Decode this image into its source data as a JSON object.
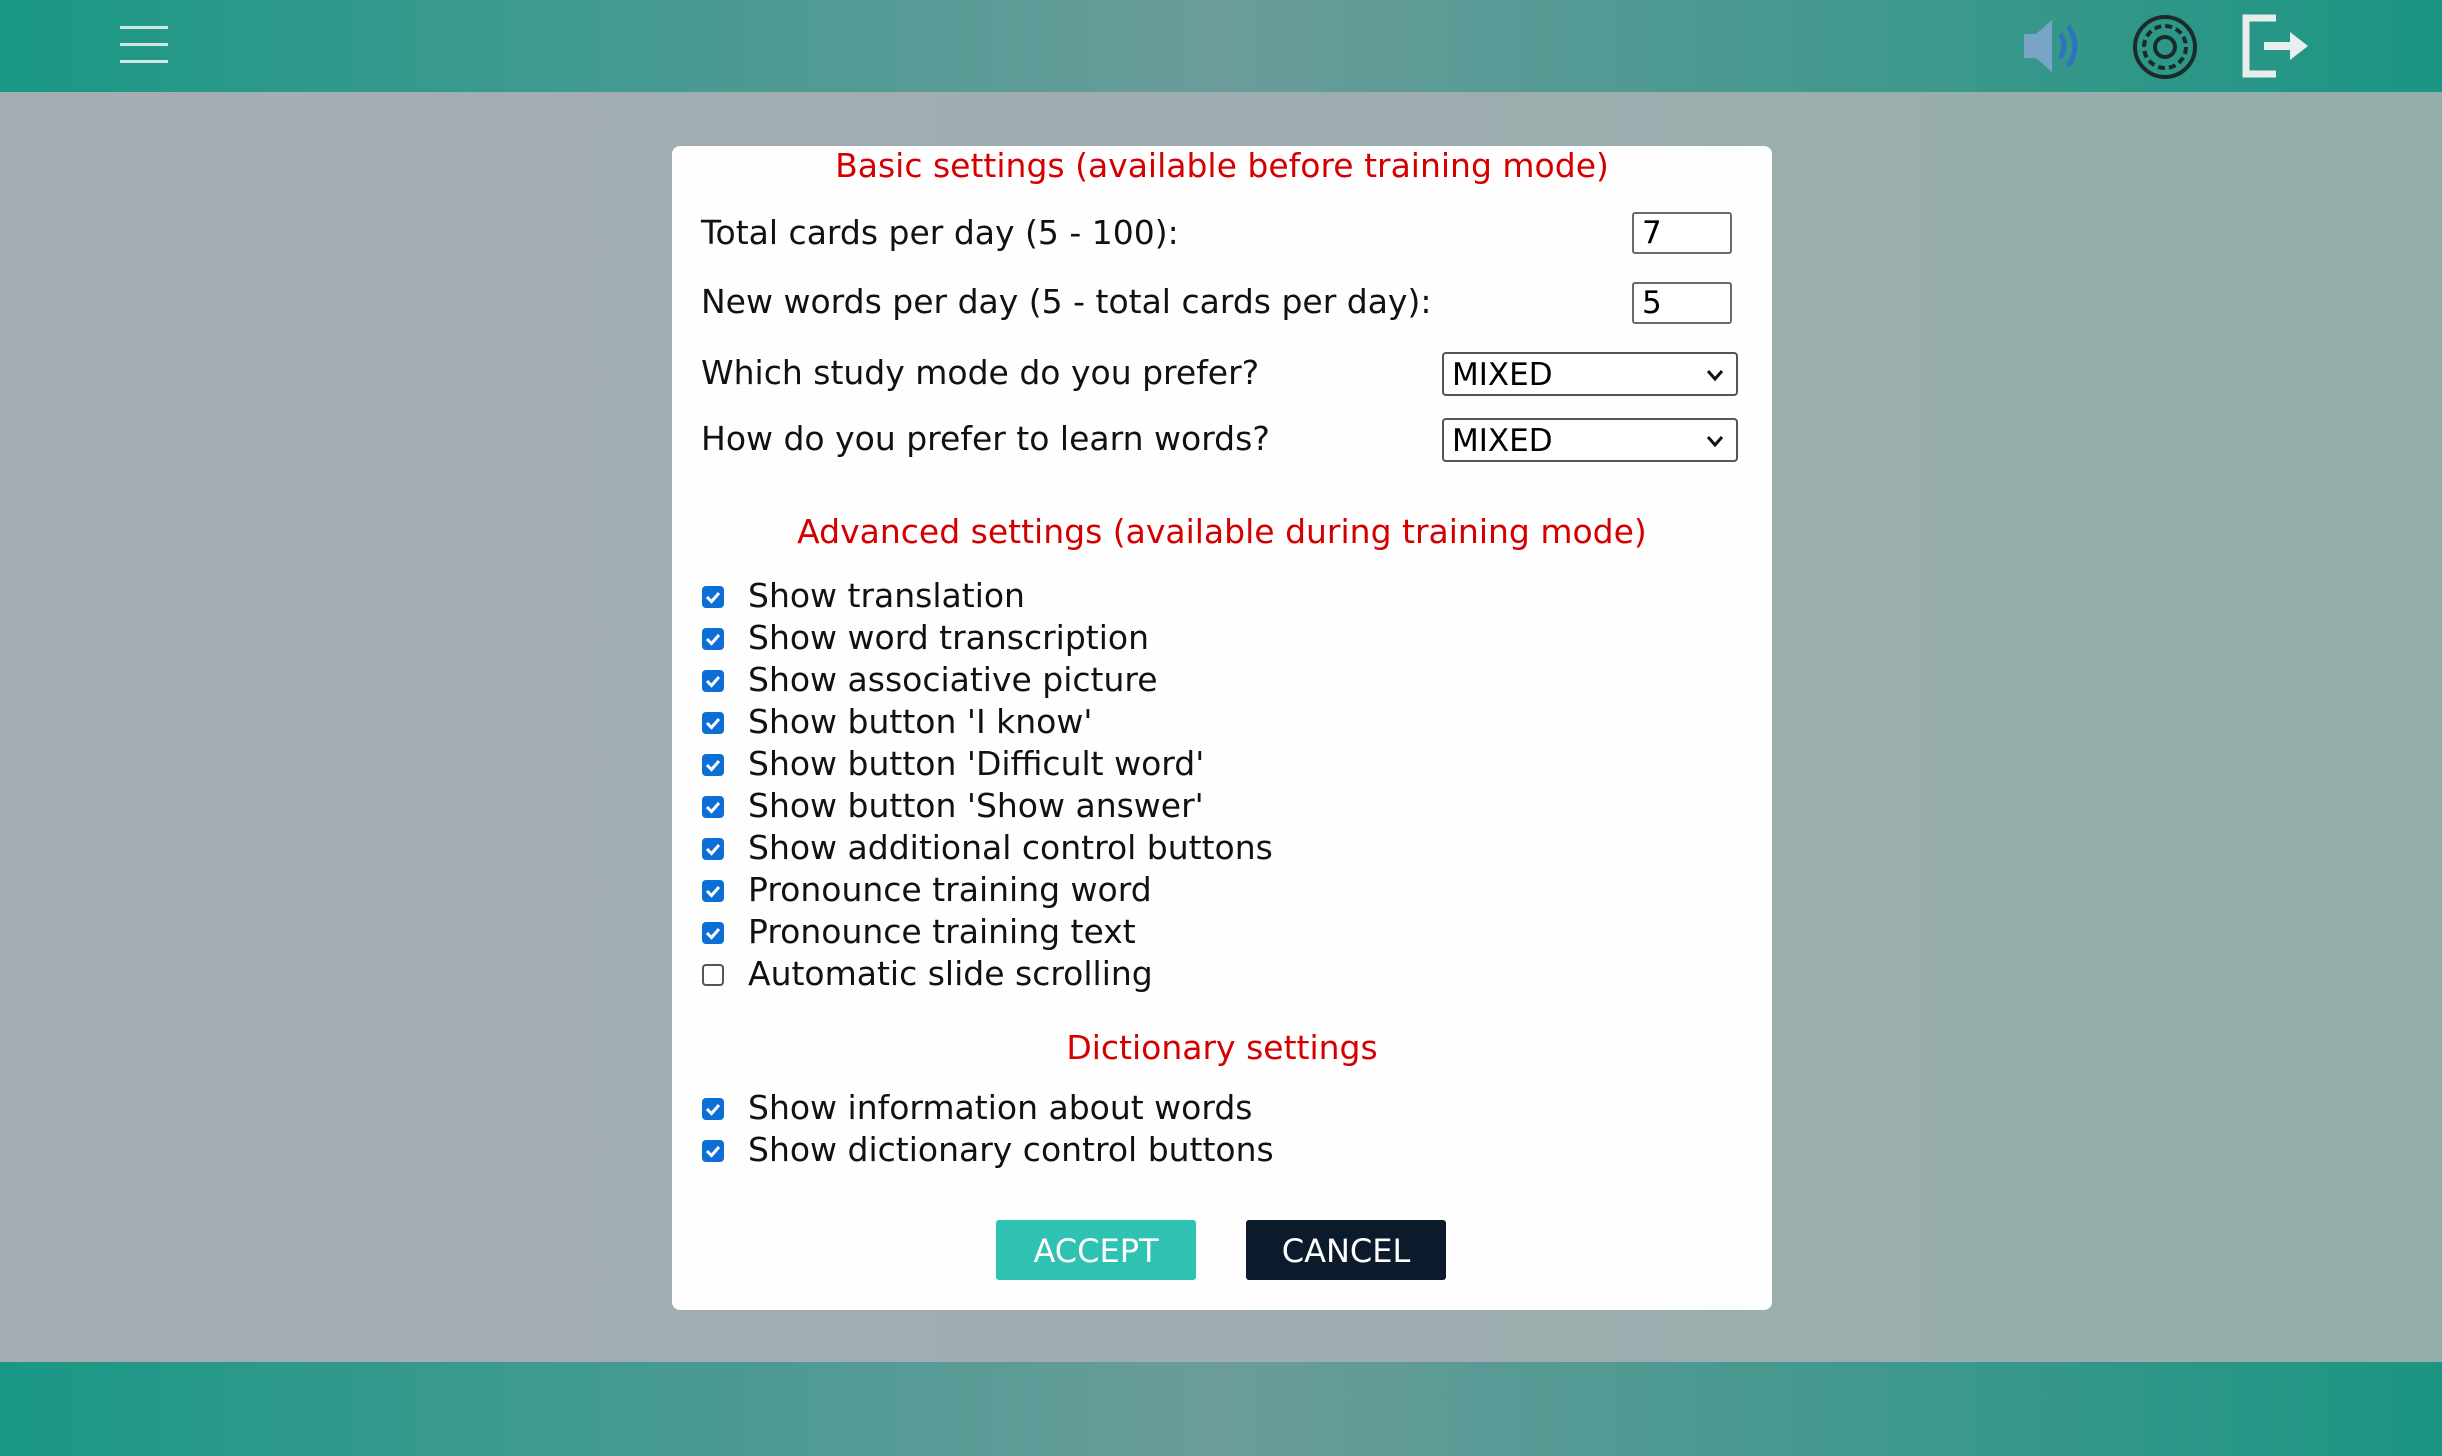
{
  "header": {
    "menu_icon": "hamburger-menu-icon",
    "sound_icon": "speaker-icon",
    "settings_icon": "gear-icon",
    "logout_icon": "logout-icon"
  },
  "modal": {
    "basic_title": "Basic settings (available before training mode)",
    "total_cards_label": "Total cards per day (5 - 100):",
    "total_cards_value": "7",
    "new_words_label": "New words per day (5 - total cards per day):",
    "new_words_value": "5",
    "study_mode_label": "Which study mode do you prefer?",
    "study_mode_value": "MIXED",
    "learn_words_label": "How do you prefer to learn words?",
    "learn_words_value": "MIXED",
    "advanced_title": "Advanced settings (available during training mode)",
    "advanced_options": [
      {
        "label": "Show translation",
        "checked": true
      },
      {
        "label": "Show word transcription",
        "checked": true
      },
      {
        "label": "Show associative picture",
        "checked": true
      },
      {
        "label": "Show button 'I know'",
        "checked": true
      },
      {
        "label": "Show button 'Difficult word'",
        "checked": true
      },
      {
        "label": "Show button 'Show answer'",
        "checked": true
      },
      {
        "label": "Show additional control buttons",
        "checked": true
      },
      {
        "label": "Pronounce training word",
        "checked": true
      },
      {
        "label": "Pronounce training text",
        "checked": true
      },
      {
        "label": "Automatic slide scrolling",
        "checked": false
      }
    ],
    "dictionary_title": "Dictionary settings",
    "dictionary_options": [
      {
        "label": "Show information about words",
        "checked": true
      },
      {
        "label": "Show dictionary control buttons",
        "checked": true
      }
    ],
    "accept_label": "ACCEPT",
    "cancel_label": "CANCEL"
  },
  "colors": {
    "header_teal": "#1a9885",
    "title_red": "#d40000",
    "accept_bg": "#2fc2b3",
    "cancel_bg": "#0b1b2b",
    "checkbox_blue": "#0b6fd6"
  }
}
